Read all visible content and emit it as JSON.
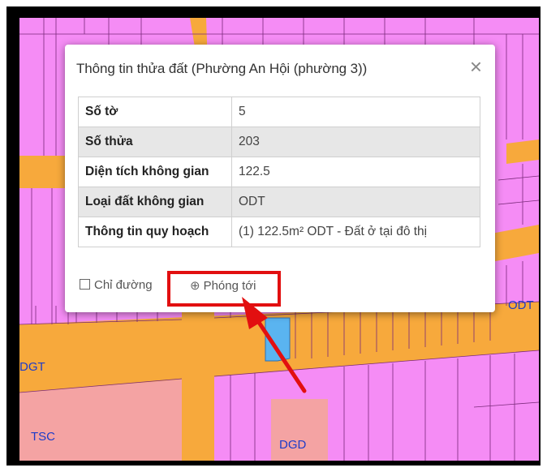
{
  "popup": {
    "title": "Thông tin thửa đất (Phường An Hội (phường 3))",
    "close_glyph": "×",
    "rows": [
      {
        "key": "Số tờ",
        "value": "5"
      },
      {
        "key": "Số thửa",
        "value": "203"
      },
      {
        "key": "Diện tích không gian",
        "value": "122.5"
      },
      {
        "key": "Loại đất không gian",
        "value": "ODT"
      },
      {
        "key": "Thông tin quy hoạch",
        "value": "(1) 122.5m² ODT - Đất ở tại đô thị"
      }
    ],
    "actions": {
      "directions_label": "Chỉ đường",
      "zoom_label": "Phóng tới"
    }
  },
  "map": {
    "labels": {
      "odt": "ODT",
      "dgt": "DGT",
      "tsc": "TSC",
      "dgd": "DGD"
    },
    "colors": {
      "residential": "#f58cf5",
      "road": "#f7a93c",
      "public": "#f4a3a3",
      "selected": "#5ab4f0"
    }
  },
  "annotation": {
    "color": "#e20f10"
  }
}
